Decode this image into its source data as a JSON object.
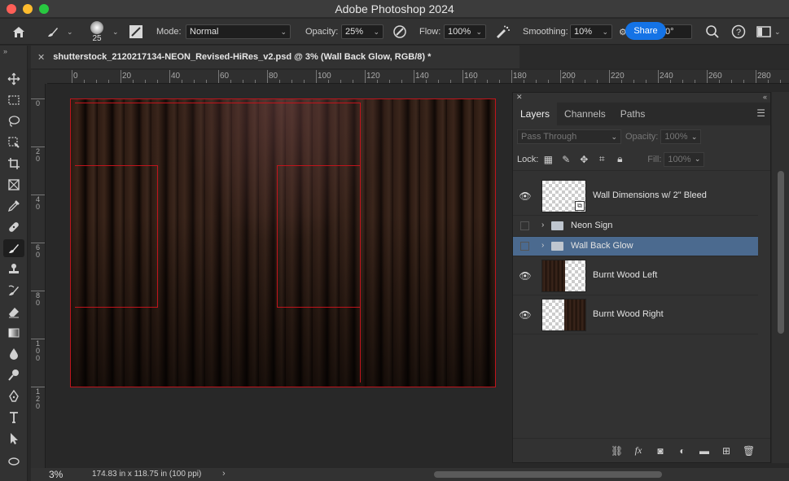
{
  "window": {
    "title": "Adobe Photoshop 2024"
  },
  "options_bar": {
    "brush_size": "25",
    "mode_label": "Mode:",
    "mode_value": "Normal",
    "opacity_label": "Opacity:",
    "opacity_value": "25%",
    "flow_label": "Flow:",
    "flow_value": "100%",
    "smoothing_label": "Smoothing:",
    "smoothing_value": "10%",
    "angle_value": "0°",
    "share_label": "Share"
  },
  "document_tab": {
    "title": "shutterstock_2120217134-NEON_Revised-HiRes_v2.psd @ 3% (Wall Back Glow, RGB/8) *"
  },
  "rulers": {
    "top_ticks": [
      "0",
      "20",
      "40",
      "60",
      "80",
      "100",
      "120",
      "140",
      "160",
      "180",
      "200",
      "220",
      "240",
      "260",
      "280"
    ],
    "left_ticks": [
      "0",
      "2 0",
      "4 0",
      "6 0",
      "8 0",
      "1 0 0",
      "1 2 0"
    ]
  },
  "status_bar": {
    "zoom": "3%",
    "doc_size": "174.83 in x 118.75 in (100 ppi)"
  },
  "layers_panel": {
    "tabs": [
      "Layers",
      "Channels",
      "Paths"
    ],
    "blend_mode": "Pass Through",
    "opacity_label": "Opacity:",
    "opacity_value": "100%",
    "lock_label": "Lock:",
    "fill_label": "Fill:",
    "fill_value": "100%",
    "layers": [
      {
        "name": "Wall Dimensions w/ 2\" Bleed",
        "visible": true,
        "type": "smart-object"
      },
      {
        "name": "Neon Sign",
        "visible": false,
        "type": "group"
      },
      {
        "name": "Wall Back Glow",
        "visible": false,
        "type": "group",
        "selected": true
      },
      {
        "name": "Burnt Wood Left",
        "visible": true,
        "type": "pixel"
      },
      {
        "name": "Burnt Wood Right",
        "visible": true,
        "type": "pixel"
      }
    ]
  },
  "colors": {
    "accent": "#1473e6",
    "selection": "#4b6a8f",
    "guide_red": "#c0141c"
  }
}
